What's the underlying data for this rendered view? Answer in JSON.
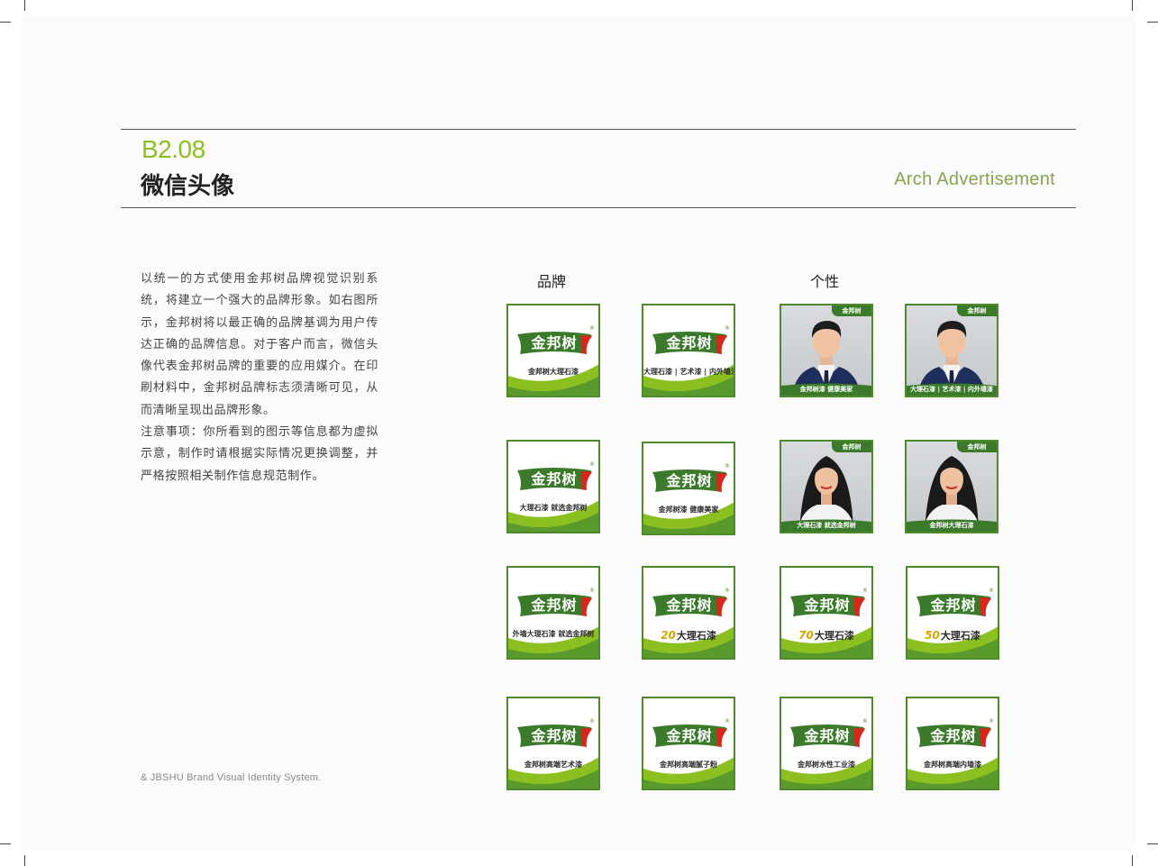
{
  "header": {
    "code": "B2.08",
    "title": "微信头像",
    "right_label": "Arch Advertisement"
  },
  "intro": {
    "paragraph1": "以统一的方式使用金邦树品牌视觉识别系统，将建立一个强大的品牌形象。如右图所示，金邦树将以最正确的品牌基调为用户传达正确的品牌信息。对于客户而言，微信头像代表金邦树品牌的重要的应用媒介。在印刷材料中，金邦树品牌标志须清晰可见，从而清晰呈现出品牌形象。",
    "paragraph2": "注意事项：你所看到的图示等信息都为虚拟示意，制作时请根据实际情况更换调整，并严格按照相关制作信息规范制作。"
  },
  "columns": {
    "brand": "品牌",
    "personal": "个性"
  },
  "logo_text": "金邦树",
  "logo_reg": "®",
  "corner_label": "金邦树",
  "tiles": [
    {
      "tag": "金邦树大理石漆",
      "num": ""
    },
    {
      "tag": "大理石漆 | 艺术漆 | 内外墙漆",
      "num": ""
    },
    {
      "tag": "大理石漆 就选金邦树",
      "num": ""
    },
    {
      "tag": "金邦树漆 健康美家",
      "num": ""
    },
    {
      "tag": "外墙大理石漆 就选金邦树",
      "num": ""
    },
    {
      "tag": "大理石漆",
      "num": "20"
    },
    {
      "tag": "大理石漆",
      "num": "70"
    },
    {
      "tag": "大理石漆",
      "num": "50"
    },
    {
      "tag": "金邦树高端艺术漆",
      "num": ""
    },
    {
      "tag": "金邦树高端腻子粉",
      "num": ""
    },
    {
      "tag": "金邦树水性工业漆",
      "num": ""
    },
    {
      "tag": "金邦树高端内墙漆",
      "num": ""
    }
  ],
  "photos": [
    {
      "band": "金邦树漆  健康美家"
    },
    {
      "band": "大理石漆 | 艺术漆 | 内外墙漆"
    },
    {
      "band": "大理石漆 就选金邦树"
    },
    {
      "band": "金邦树大理石漆"
    }
  ],
  "footer": "& JBSHU Brand Visual Identity System.",
  "colors": {
    "accent_green": "#8cc021",
    "brand_dark_green": "#3b7a2a",
    "brand_red": "#d9261c",
    "gold": "#d7a500"
  }
}
